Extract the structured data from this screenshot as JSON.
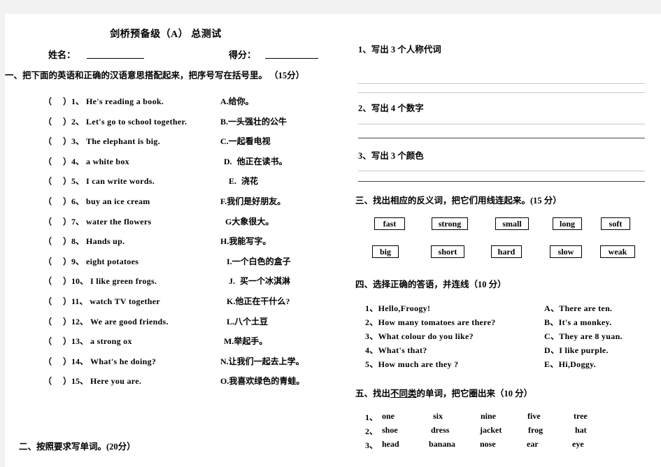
{
  "document": {
    "title": "剑桥预备级（A）   总测试",
    "name_label": "姓名：",
    "score_label": "得分："
  },
  "section1": {
    "heading": "一、把下面的英语和正确的汉语意思搭配起来，把序号写在括号里。 （15分）",
    "english_items": [
      {
        "num": "1、",
        "text": "He's reading a book."
      },
      {
        "num": "2、",
        "text": "Let's go to school together."
      },
      {
        "num": "3、",
        "text": "The elephant is big."
      },
      {
        "num": "4、",
        "text": "a white box"
      },
      {
        "num": "5、",
        "text": "I can write words."
      },
      {
        "num": "6、",
        "text": "buy an ice cream"
      },
      {
        "num": "7、",
        "text": "water the flowers"
      },
      {
        "num": "8、",
        "text": "Hands up."
      },
      {
        "num": "9、",
        "text": "eight potatoes"
      },
      {
        "num": "10、",
        "text": "I like green frogs."
      },
      {
        "num": "11、",
        "text": "watch TV together"
      },
      {
        "num": "12、",
        "text": "We are good friends."
      },
      {
        "num": "13、",
        "text": "a strong ox"
      },
      {
        "num": "14、",
        "text": "What's he doing?"
      },
      {
        "num": "15、",
        "text": "Here you are."
      }
    ],
    "chinese_items": [
      {
        "key": "A.",
        "text": "给你。"
      },
      {
        "key": "B.",
        "text": "一头强壮的公牛"
      },
      {
        "key": "C.",
        "text": "一起看电视"
      },
      {
        "key": "D.",
        "text": "他正在读书。"
      },
      {
        "key": "E.",
        "text": "浇花"
      },
      {
        "key": "F.",
        "text": "我们是好朋友。"
      },
      {
        "key": "G",
        "text": "大象很大。"
      },
      {
        "key": "H.",
        "text": "我能写字。"
      },
      {
        "key": "I.",
        "text": "一个白色的盒子"
      },
      {
        "key": "J.",
        "text": "买一个冰淇淋"
      },
      {
        "key": "K.",
        "text": "他正在干什么?"
      },
      {
        "key": "L.",
        "text": "八个土豆"
      },
      {
        "key": "M.",
        "text": "举起手。"
      },
      {
        "key": "N.",
        "text": "让我们一起去上学。"
      },
      {
        "key": "O.",
        "text": "我喜欢绿色的青蛙。"
      }
    ]
  },
  "section2": {
    "heading": "二、按照要求写单词。(20分）",
    "prompts": [
      {
        "text": "1、写出 3 个人称代词"
      },
      {
        "text": "2、写出 4 个数字"
      },
      {
        "text": "3、写出 3 个颜色"
      }
    ]
  },
  "section3": {
    "heading": "三、找出相应的反义词，把它们用线连起来。(15 分）",
    "row_top": [
      "fast",
      "strong",
      "small",
      "long",
      "soft"
    ],
    "row_bottom": [
      "big",
      "short",
      "hard",
      "slow",
      "weak"
    ]
  },
  "section4": {
    "heading": "四、选择正确的答语，并连线（10 分）",
    "questions": [
      "1、Hello,Froogy!",
      "2、How many tomatoes are there?",
      "3、What colour do you like?",
      "4、What's that?",
      "5、How much are they ?"
    ],
    "answers": [
      "A、There are ten.",
      "B、It's a monkey.",
      "C、They are 8 yuan.",
      "D、I like purple.",
      "E、Hi,Doggy."
    ]
  },
  "section5": {
    "heading_pre": "五、找出",
    "heading_underline": "不同类",
    "heading_post": "的单词，把它圈出来（10 分）",
    "rows": [
      {
        "num": "1、",
        "words": [
          "one",
          "six",
          "nine",
          "five",
          "tree"
        ]
      },
      {
        "num": "2、",
        "words": [
          "shoe",
          "dress",
          "jacket",
          "frog",
          "hat"
        ]
      },
      {
        "num": "3、",
        "words": [
          "head",
          "banana",
          "nose",
          "ear",
          "eye"
        ]
      }
    ]
  }
}
